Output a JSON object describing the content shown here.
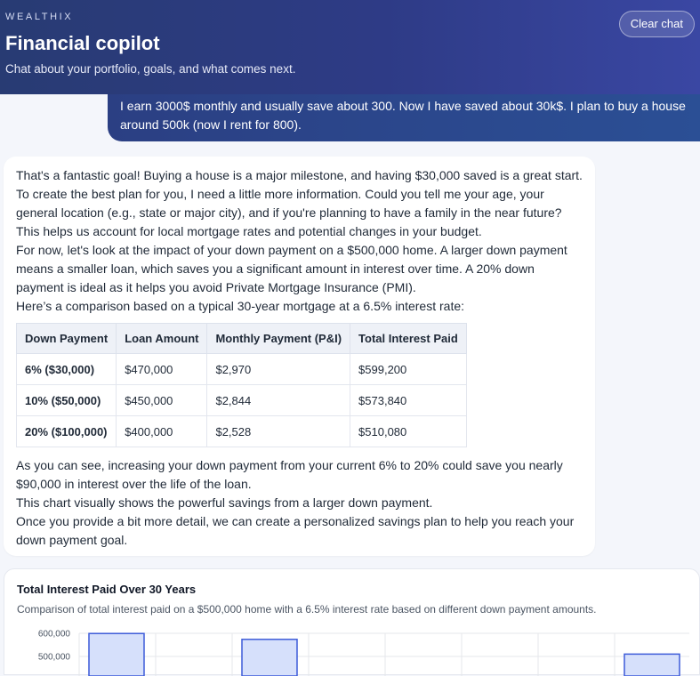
{
  "header": {
    "brand": "WEALTHIX",
    "title": "Financial copilot",
    "subtitle": "Chat about your portfolio, goals, and what comes next.",
    "clear_label": "Clear chat"
  },
  "user_message": "I earn 3000$ monthly and usually save about 300. Now I have saved about 30k$. I plan to buy a house around 500k (now I rent for 800).",
  "assistant_message": {
    "intro_paragraphs": [
      "That's a fantastic goal! Buying a house is a major milestone, and having $30,000 saved is a great start. To create the best plan for you, I need a little more information. Could you tell me your age, your general location (e.g., state or major city), and if you're planning to have a family in the near future? This helps us account for local mortgage rates and potential changes in your budget.",
      "For now, let's look at the impact of your down payment on a $500,000 home. A larger down payment means a smaller loan, which saves you a significant amount in interest over time. A 20% down payment is ideal as it helps you avoid Private Mortgage Insurance (PMI).",
      "Here’s a comparison based on a typical 30-year mortgage at a 6.5% interest rate:"
    ],
    "table": {
      "headers": [
        "Down Payment",
        "Loan Amount",
        "Monthly Payment (P&I)",
        "Total Interest Paid"
      ],
      "rows": [
        [
          "6% ($30,000)",
          "$470,000",
          "$2,970",
          "$599,200"
        ],
        [
          "10% ($50,000)",
          "$450,000",
          "$2,844",
          "$573,840"
        ],
        [
          "20% ($100,000)",
          "$400,000",
          "$2,528",
          "$510,080"
        ]
      ]
    },
    "outro_paragraphs": [
      "As you can see, increasing your down payment from your current 6% to 20% could save you nearly $90,000 in interest over the life of the loan.",
      "This chart visually shows the powerful savings from a larger down payment.",
      "Once you provide a bit more detail, we can create a personalized savings plan to help you reach your down payment goal."
    ]
  },
  "chart_card": {
    "title": "Total Interest Paid Over 30 Years",
    "description": "Comparison of total interest paid on a $500,000 home with a 6.5% interest rate based on different down payment amounts."
  },
  "chart_data": {
    "type": "bar",
    "title": "Total Interest Paid Over 30 Years",
    "y_ticks": [
      "600,000",
      "500,000"
    ],
    "ylim": [
      0,
      600000
    ],
    "values": [
      599200,
      573840,
      510080
    ],
    "grid": true,
    "colors": {
      "bar_fill": "#d6e0fb",
      "bar_stroke": "#3d5bd9",
      "grid": "#e5e7eb"
    }
  },
  "colors": {
    "header_start": "#283b73",
    "header_end": "#3a47a3",
    "user_bubble": "#2b4795",
    "page_bg": "#f4f6fb"
  }
}
